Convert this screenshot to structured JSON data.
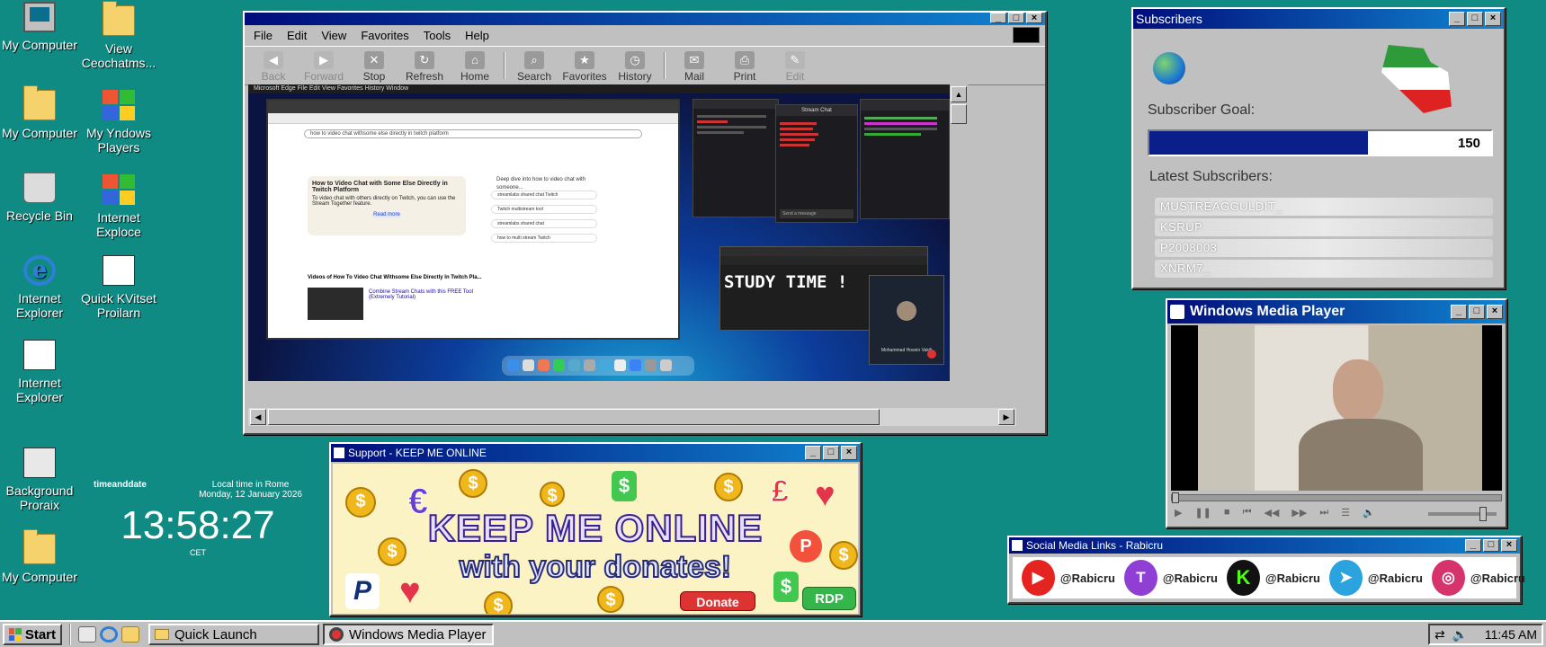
{
  "desktop": {
    "icons": [
      {
        "label": "My Computer",
        "icon": "computer-icon"
      },
      {
        "label": "View Ceochatms...",
        "icon": "folder-icon"
      },
      {
        "label": "My Computer",
        "icon": "folder-documents-icon"
      },
      {
        "label": "My Yndows Players",
        "icon": "windows-logo-icon"
      },
      {
        "label": "Recycle Bin",
        "icon": "recycle-bin-icon"
      },
      {
        "label": "Internet Exploce",
        "icon": "windows-logo-icon"
      },
      {
        "label": "Internet Explorer",
        "icon": "internet-explorer-icon"
      },
      {
        "label": "Quick KVitset Proilarn",
        "icon": "document-icon"
      },
      {
        "label": "Internet Explorer",
        "icon": "document-icon"
      },
      {
        "label": "Background Proraix",
        "icon": "display-properties-icon"
      },
      {
        "label": "My Computer",
        "icon": "folder-icon"
      }
    ]
  },
  "clock_widget": {
    "brand": "timeanddate",
    "heading": "Local time in Rome",
    "date": "Monday, 12 January 2026",
    "time": "13:58:27",
    "tz": "CET"
  },
  "browser": {
    "menu": [
      "File",
      "Edit",
      "View",
      "Favorites",
      "Tools",
      "Help"
    ],
    "toolbar": [
      {
        "label": "Back",
        "enabled": false
      },
      {
        "label": "Forward",
        "enabled": false
      },
      {
        "label": "Stop",
        "enabled": true
      },
      {
        "label": "Refresh",
        "enabled": true
      },
      {
        "label": "Home",
        "enabled": true
      },
      {
        "label": "Search",
        "enabled": true
      },
      {
        "label": "Favorites",
        "enabled": true
      },
      {
        "label": "History",
        "enabled": true
      },
      {
        "label": "Mail",
        "enabled": true
      },
      {
        "label": "Print",
        "enabled": true
      },
      {
        "label": "Edit",
        "enabled": false
      }
    ],
    "screen": {
      "search_query": "how to video chat withsome else directly in twitch platform",
      "card_title": "How to Video Chat with Some Else Directly in Twitch Platform",
      "card_text": "To video chat with others directly on Twitch, you can use the Stream Together feature.",
      "read_more": "Read more",
      "side_title": "Deep dive into how to video chat with someone...",
      "side_items": [
        "streamlabs shared chat Twitch",
        "Twitch multistream tool",
        "streamlabs shared chat",
        "how to multi stream Twitch"
      ],
      "videos_heading": "Videos of How To Video Chat Withsome Else Directly In Twitch Pla...",
      "video_title": "Combine Stream Chats with this FREE Tool (Extremely Tutorial)",
      "chat_header": "Stream Chat",
      "send_message": "Send a message",
      "study_text": "STUDY TIME !",
      "meet_name": "Mohammad Hosein Vakili"
    }
  },
  "subscribers": {
    "title": "Subscribers",
    "goal_label": "Subscriber Goal:",
    "goal_value": "150",
    "goal_progress": 0.64,
    "latest_label": "Latest Subscribers:",
    "latest": [
      "MUSTREAGGULDIT_",
      "KSRUP",
      "P2008003",
      "XNRM7_"
    ]
  },
  "media_player": {
    "title": "Windows Media Player",
    "seek_progress": 0.0,
    "volume": 0.8
  },
  "support": {
    "title": "Support - KEEP ME ONLINE",
    "headline": "KEEP ME ONLINE",
    "subline": "with your donates!",
    "donate": "Donate",
    "rdp": "RDP",
    "pay_symbols": [
      "$",
      "€",
      "£",
      "P"
    ]
  },
  "social": {
    "title": "Social Media Links - Rabicru",
    "links": [
      {
        "network": "youtube",
        "handle": "@Rabicru",
        "color": "#e52421",
        "glyph": "▶"
      },
      {
        "network": "twitch",
        "handle": "@Rabicru",
        "color": "#8f3fd4",
        "glyph": "T"
      },
      {
        "network": "kick",
        "handle": "@Rabicru",
        "color": "#111111",
        "glyph": "K"
      },
      {
        "network": "telegram",
        "handle": "@Rabicru",
        "color": "#2aa3de",
        "glyph": "➤"
      },
      {
        "network": "instagram",
        "handle": "@Rabicru",
        "color": "#d6326b",
        "glyph": "◎"
      }
    ]
  },
  "taskbar": {
    "start": "Start",
    "quick_launch": "Quick Launch",
    "active_task": "Windows Media Player",
    "time": "11:45 AM"
  },
  "colors": {
    "desktop": "#0f8b83",
    "titlebar": "#000d7a",
    "progress": "#0a1f8a"
  }
}
